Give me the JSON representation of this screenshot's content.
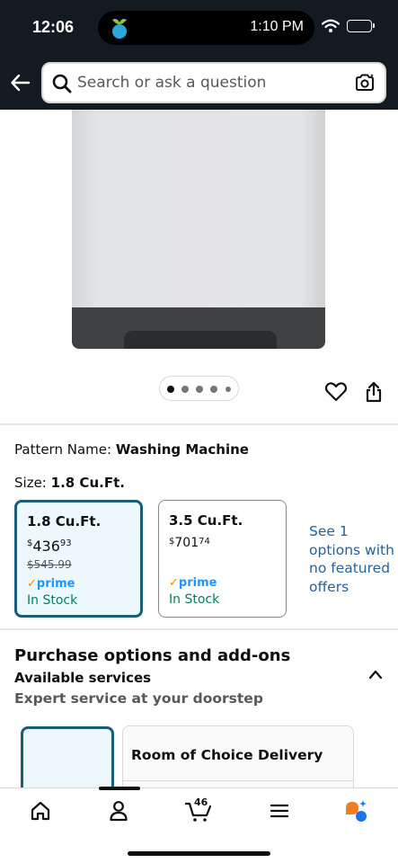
{
  "status_bar": {
    "time": "12:06",
    "island_time": "1:10 PM"
  },
  "search": {
    "placeholder": "Search or ask a question"
  },
  "product": {
    "image_count": 5,
    "active_image": 1
  },
  "pattern": {
    "label": "Pattern Name:",
    "value": "Washing Machine"
  },
  "size": {
    "label": "Size:",
    "value": "1.8 Cu.Ft."
  },
  "size_options": [
    {
      "title": "1.8 Cu.Ft.",
      "currency": "$",
      "price_whole": "436",
      "price_fraction": "93",
      "list_price": "$545.99",
      "prime": "prime",
      "stock": "In Stock"
    },
    {
      "title": "3.5 Cu.Ft.",
      "currency": "$",
      "price_whole": "701",
      "price_fraction": "74",
      "prime": "prime",
      "stock": "In Stock"
    }
  ],
  "see_more": "See 1 options with no featured offers",
  "purchase_options": {
    "title": "Purchase options and add-ons",
    "available_services": "Available services",
    "expert_service": "Expert service at your doorstep",
    "service_card_title": "Room of Choice Delivery"
  },
  "bottom_nav": {
    "cart_count": "46"
  },
  "colors": {
    "header_bg": "#131a22",
    "selected_border": "#1b5c79",
    "selected_bg": "#edf8fd",
    "link": "#2162a1",
    "in_stock": "#067d62",
    "prime_blue": "#1a98ff",
    "prime_check": "#f08804"
  }
}
